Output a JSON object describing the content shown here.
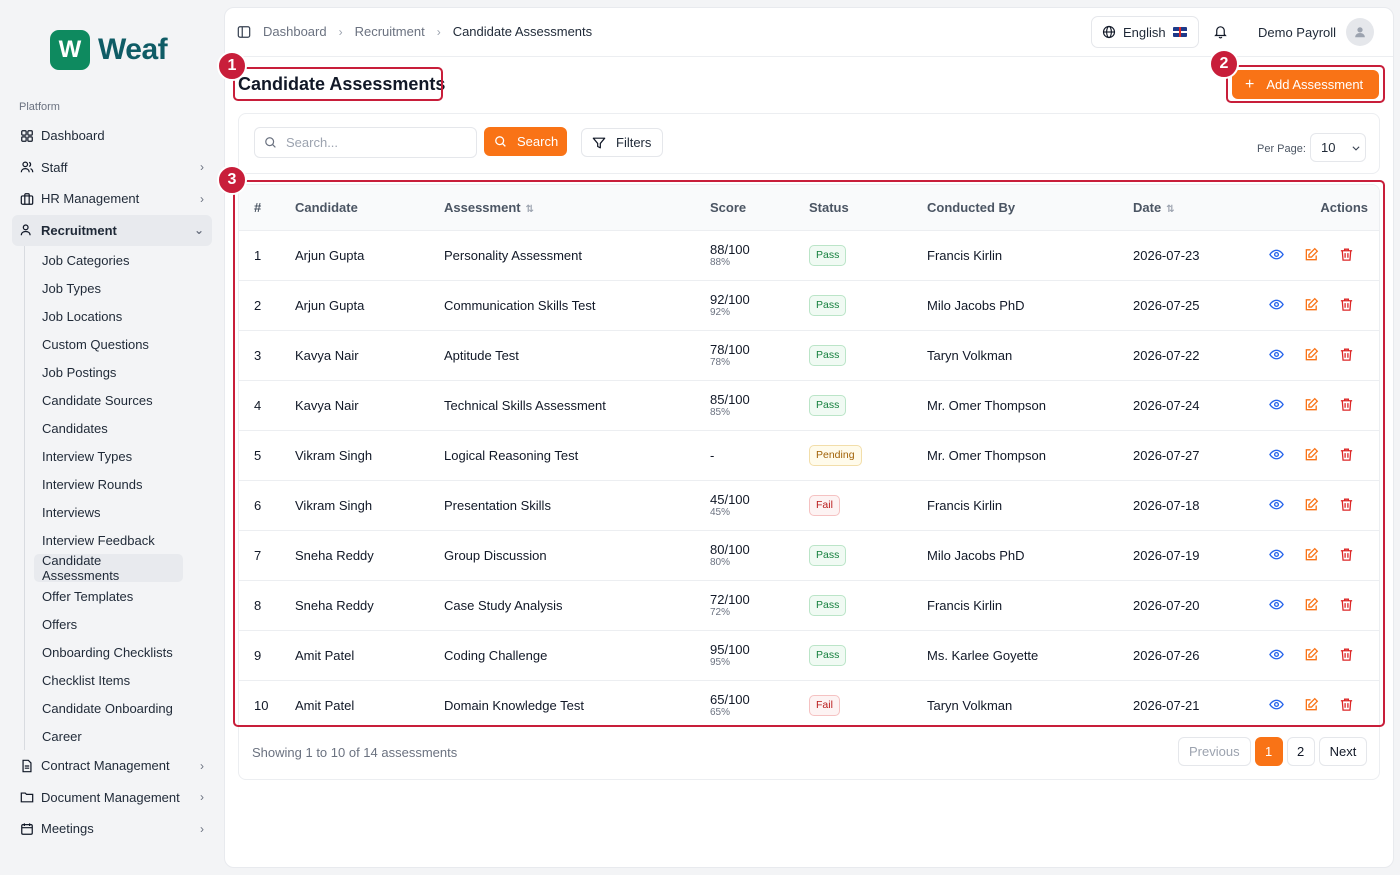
{
  "brand": {
    "name": "Weaf",
    "mark": "W"
  },
  "sidebar": {
    "section_label": "Platform",
    "items": [
      {
        "label": "Dashboard",
        "icon": "grid-icon",
        "chevron": false
      },
      {
        "label": "Staff",
        "icon": "users-icon",
        "chevron": true
      },
      {
        "label": "HR Management",
        "icon": "briefcase-icon",
        "chevron": true
      },
      {
        "label": "Recruitment",
        "icon": "user-plus-icon",
        "chevron": true,
        "open": true
      }
    ],
    "recruitment_sub": [
      "Job Categories",
      "Job Types",
      "Job Locations",
      "Custom Questions",
      "Job Postings",
      "Candidate Sources",
      "Candidates",
      "Interview Types",
      "Interview Rounds",
      "Interviews",
      "Interview Feedback",
      "Candidate Assessments",
      "Offer Templates",
      "Offers",
      "Onboarding Checklists",
      "Checklist Items",
      "Candidate Onboarding",
      "Career"
    ],
    "after_items": [
      {
        "label": "Contract Management",
        "icon": "file-icon"
      },
      {
        "label": "Document Management",
        "icon": "folder-icon"
      },
      {
        "label": "Meetings",
        "icon": "calendar-icon"
      }
    ]
  },
  "breadcrumb": [
    "Dashboard",
    "Recruitment",
    "Candidate Assessments"
  ],
  "header": {
    "language": "English",
    "user_name": "Demo Payroll"
  },
  "page": {
    "title": "Candidate Assessments",
    "add_button": "Add Assessment"
  },
  "filters": {
    "search_placeholder": "Search...",
    "search_button": "Search",
    "filters_button": "Filters",
    "per_page_label": "Per Page:",
    "per_page_value": "10"
  },
  "table": {
    "columns": [
      "#",
      "Candidate",
      "Assessment",
      "Score",
      "Status",
      "Conducted By",
      "Date",
      "Actions"
    ],
    "rows": [
      {
        "n": "1",
        "candidate": "Arjun Gupta",
        "assessment": "Personality Assessment",
        "score": "88/100",
        "pct": "88%",
        "status": "Pass",
        "by": "Francis Kirlin",
        "date": "2026-07-23"
      },
      {
        "n": "2",
        "candidate": "Arjun Gupta",
        "assessment": "Communication Skills Test",
        "score": "92/100",
        "pct": "92%",
        "status": "Pass",
        "by": "Milo Jacobs PhD",
        "date": "2026-07-25"
      },
      {
        "n": "3",
        "candidate": "Kavya Nair",
        "assessment": "Aptitude Test",
        "score": "78/100",
        "pct": "78%",
        "status": "Pass",
        "by": "Taryn Volkman",
        "date": "2026-07-22"
      },
      {
        "n": "4",
        "candidate": "Kavya Nair",
        "assessment": "Technical Skills Assessment",
        "score": "85/100",
        "pct": "85%",
        "status": "Pass",
        "by": "Mr. Omer Thompson",
        "date": "2026-07-24"
      },
      {
        "n": "5",
        "candidate": "Vikram Singh",
        "assessment": "Logical Reasoning Test",
        "score": "-",
        "pct": "",
        "status": "Pending",
        "by": "Mr. Omer Thompson",
        "date": "2026-07-27"
      },
      {
        "n": "6",
        "candidate": "Vikram Singh",
        "assessment": "Presentation Skills",
        "score": "45/100",
        "pct": "45%",
        "status": "Fail",
        "by": "Francis Kirlin",
        "date": "2026-07-18"
      },
      {
        "n": "7",
        "candidate": "Sneha Reddy",
        "assessment": "Group Discussion",
        "score": "80/100",
        "pct": "80%",
        "status": "Pass",
        "by": "Milo Jacobs PhD",
        "date": "2026-07-19"
      },
      {
        "n": "8",
        "candidate": "Sneha Reddy",
        "assessment": "Case Study Analysis",
        "score": "72/100",
        "pct": "72%",
        "status": "Pass",
        "by": "Francis Kirlin",
        "date": "2026-07-20"
      },
      {
        "n": "9",
        "candidate": "Amit Patel",
        "assessment": "Coding Challenge",
        "score": "95/100",
        "pct": "95%",
        "status": "Pass",
        "by": "Ms. Karlee Goyette",
        "date": "2026-07-26"
      },
      {
        "n": "10",
        "candidate": "Amit Patel",
        "assessment": "Domain Knowledge Test",
        "score": "65/100",
        "pct": "65%",
        "status": "Fail",
        "by": "Taryn Volkman",
        "date": "2026-07-21"
      }
    ]
  },
  "footer": {
    "showing": "Showing 1 to 10 of 14 assessments",
    "previous": "Previous",
    "pages": [
      "1",
      "2"
    ],
    "next": "Next"
  },
  "markers": [
    "1",
    "2",
    "3"
  ],
  "colors": {
    "accent": "#f97316",
    "brand": "#0e8a5f",
    "marker": "#c81e3a"
  }
}
